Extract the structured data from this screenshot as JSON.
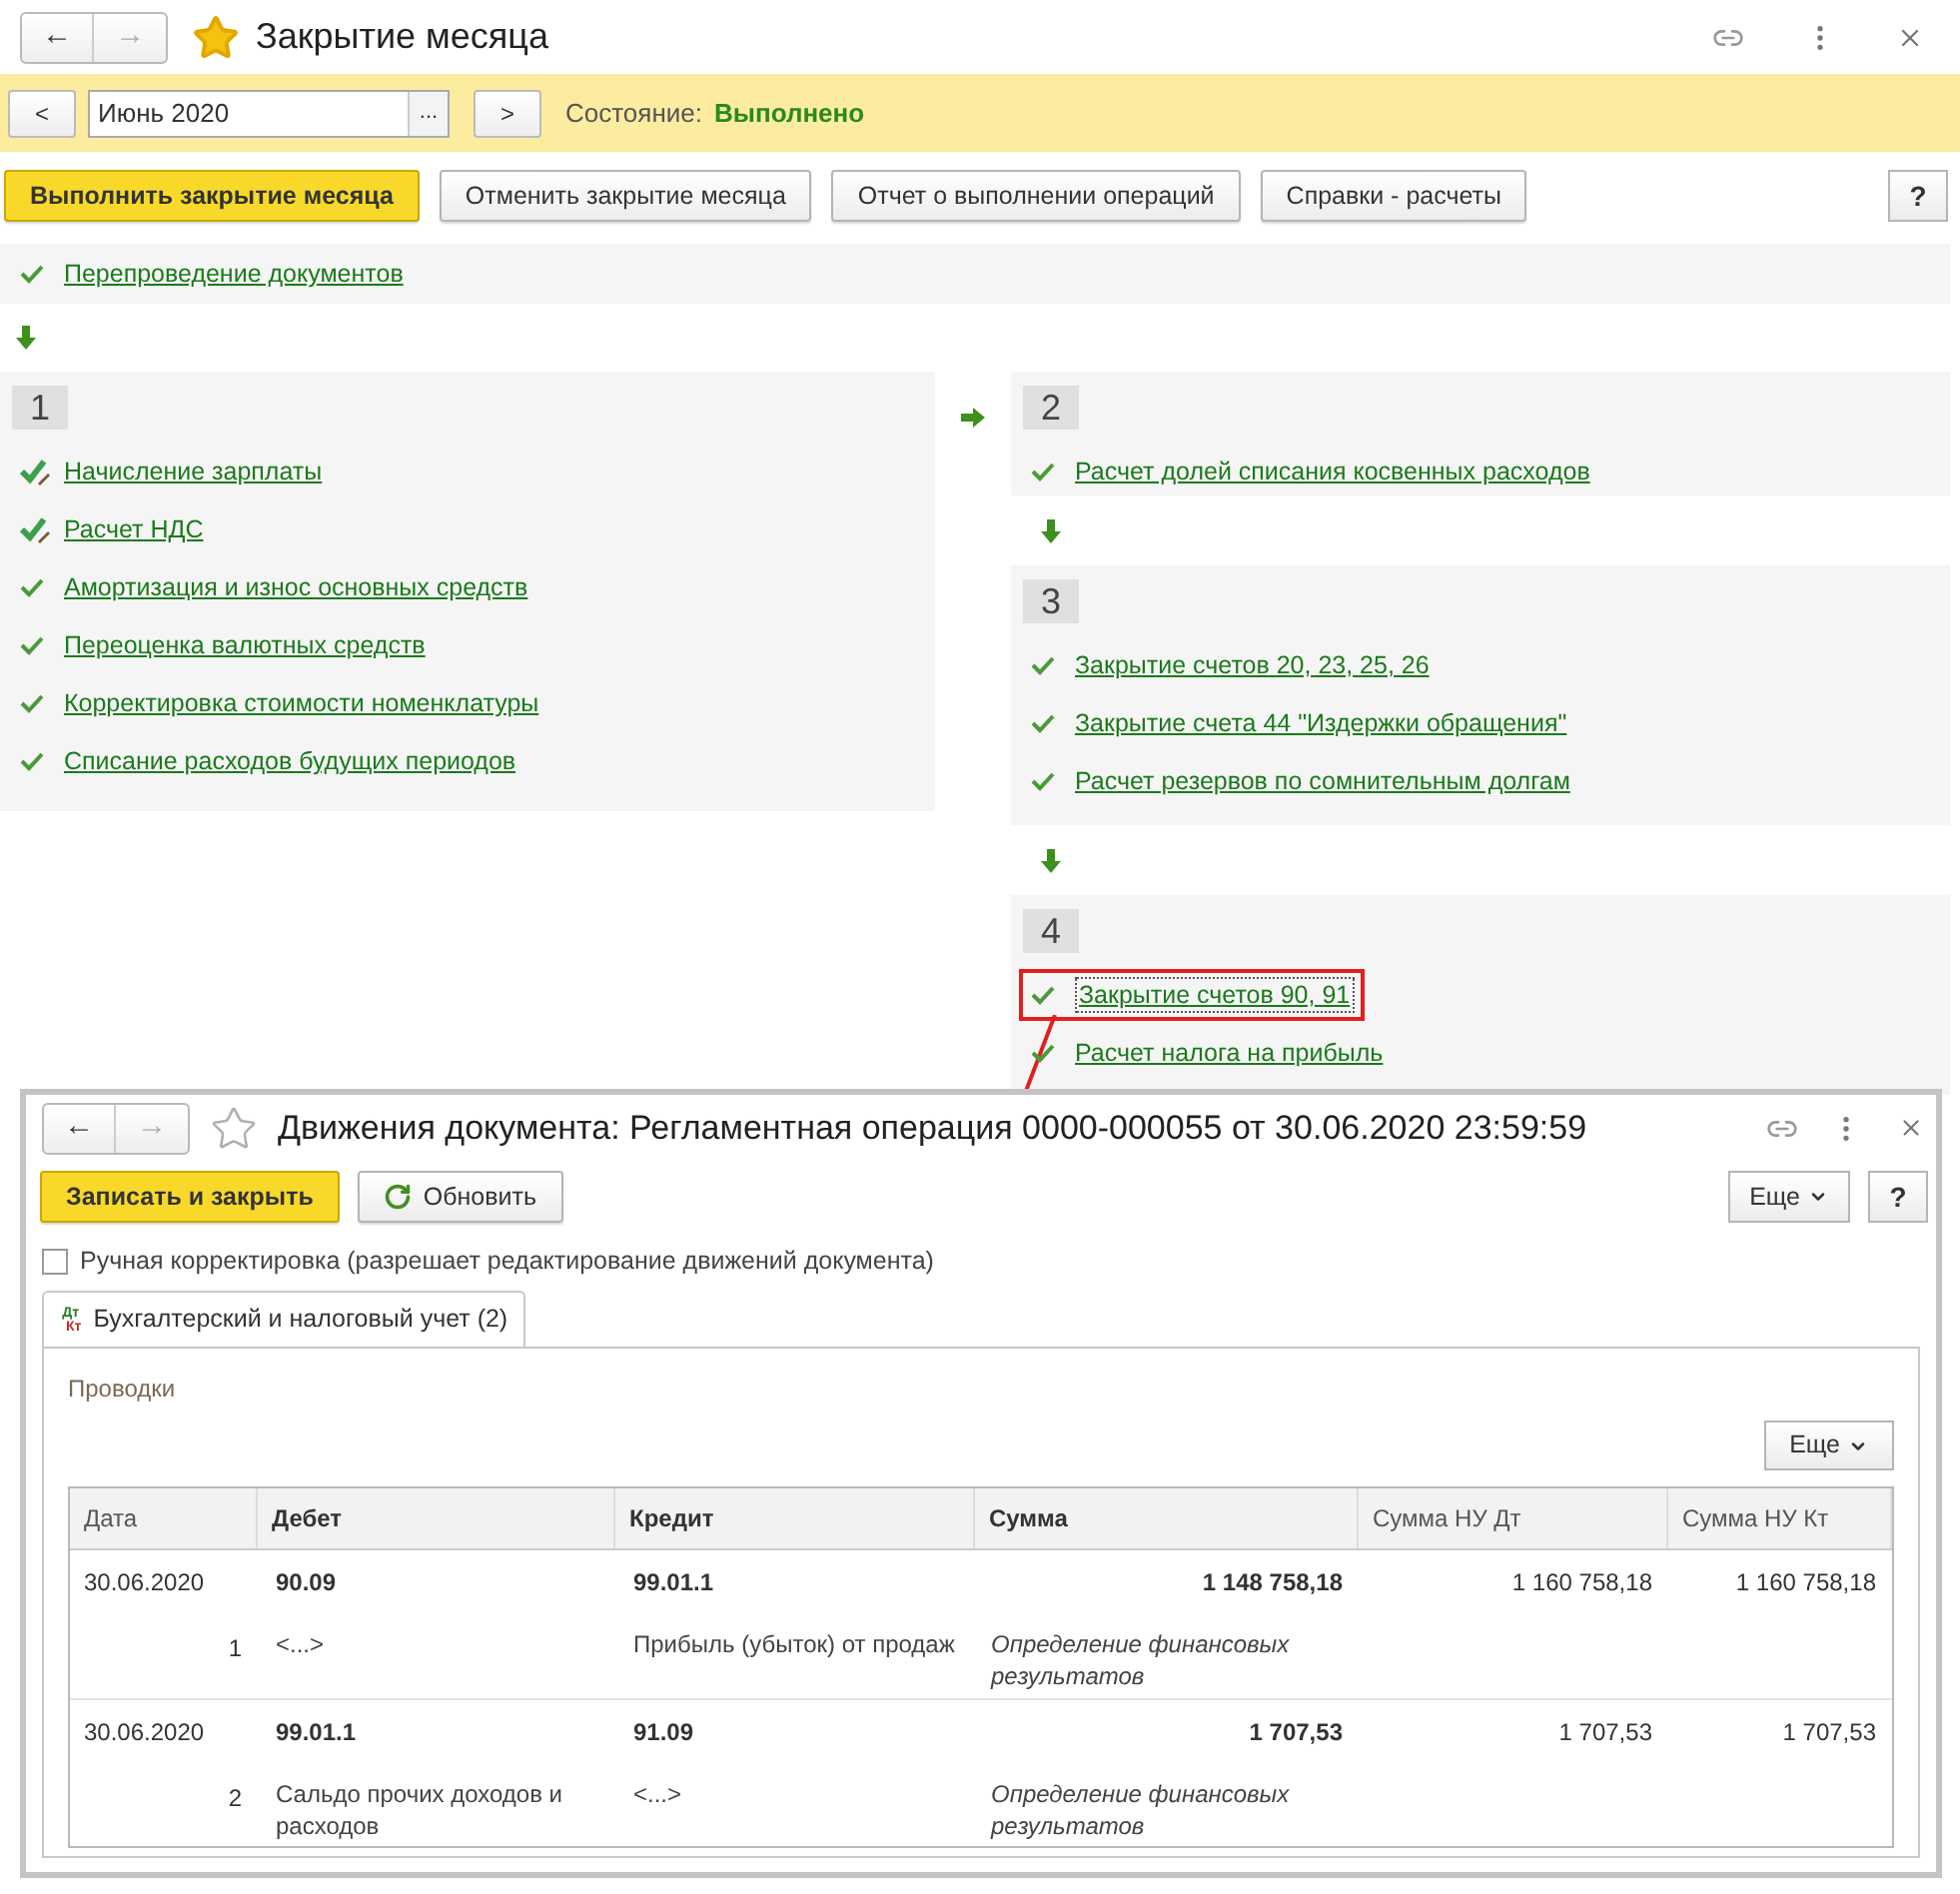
{
  "main_window": {
    "back": "←",
    "forward": "→",
    "favorite": true,
    "title": "Закрытие месяца"
  },
  "period_bar": {
    "prev": "<",
    "period": "Июнь 2020",
    "choose": "...",
    "next": ">",
    "state_label": "Состояние:",
    "state_value": "Выполнено"
  },
  "toolbar": {
    "buttons": [
      {
        "label": "Выполнить закрытие месяца",
        "kind": "primary"
      },
      {
        "label": "Отменить закрытие месяца",
        "kind": "normal"
      },
      {
        "label": "Отчет о выполнении операций",
        "kind": "normal"
      },
      {
        "label": "Справки - расчеты",
        "kind": "normal"
      }
    ],
    "help": "?"
  },
  "pre_step": {
    "label": "Перепроведение документов",
    "kind": "done"
  },
  "steps": [
    {
      "number": "1",
      "items": [
        {
          "label": "Начисление зарплаты",
          "kind": "done_edited",
          "highlighted": false
        },
        {
          "label": "Расчет НДС",
          "kind": "done_edited",
          "highlighted": false
        },
        {
          "label": "Амортизация и износ основных средств",
          "kind": "done",
          "highlighted": false
        },
        {
          "label": "Переоценка валютных средств",
          "kind": "done",
          "highlighted": false
        },
        {
          "label": "Корректировка стоимости номенклатуры",
          "kind": "done",
          "highlighted": false
        },
        {
          "label": "Списание расходов будущих периодов",
          "kind": "done",
          "highlighted": false
        }
      ]
    },
    {
      "number": "2",
      "items": [
        {
          "label": "Расчет долей списания косвенных расходов",
          "kind": "done",
          "highlighted": false
        }
      ]
    },
    {
      "number": "3",
      "items": [
        {
          "label": "Закрытие счетов 20, 23, 25, 26",
          "kind": "done",
          "highlighted": false
        },
        {
          "label": "Закрытие счета 44 \"Издержки обращения\"",
          "kind": "done",
          "highlighted": false
        },
        {
          "label": "Расчет резервов по сомнительным долгам",
          "kind": "done",
          "highlighted": false
        }
      ]
    },
    {
      "number": "4",
      "items": [
        {
          "label": "Закрытие счетов 90, 91",
          "kind": "done",
          "highlighted": true
        },
        {
          "label": "Расчет налога на прибыль",
          "kind": "done",
          "highlighted": false
        }
      ]
    }
  ],
  "document_window": {
    "back": "←",
    "forward": "→",
    "favorite": false,
    "title": "Движения документа: Регламентная операция 0000-000055 от 30.06.2020 23:59:59",
    "buttons": [
      {
        "label": "Записать и закрыть",
        "kind": "primary"
      },
      {
        "label": "Обновить",
        "kind": "refresh"
      }
    ],
    "more": "Еще",
    "help": "?",
    "manual_checkbox": {
      "label": "Ручная корректировка (разрешает редактирование движений документа)",
      "checked": false
    },
    "tabs": [
      {
        "label": "Бухгалтерский и налоговый учет (2)",
        "icon_top": "Дт",
        "icon_bottom": "Кт",
        "selected": true
      }
    ],
    "section_title": "Проводки",
    "table_more": "Еще",
    "table": {
      "columns": [
        "Дата",
        "Дебет",
        "Кредит",
        "Сумма",
        "Сумма НУ Дт",
        "Сумма НУ Кт"
      ],
      "rows": [
        {
          "date": "30.06.2020",
          "debit": "90.09",
          "credit": "99.01.1",
          "amount": "1 148 758,18",
          "nu_dt": "1 160 758,18",
          "nu_kt": "1 160 758,18",
          "line": "1",
          "debit_sub": "<...>",
          "credit_sub": "Прибыль (убыток) от продаж",
          "content": "Определение финансовых результатов"
        },
        {
          "date": "30.06.2020",
          "debit": "99.01.1",
          "credit": "91.09",
          "amount": "1 707,53",
          "nu_dt": "1 707,53",
          "nu_kt": "1 707,53",
          "line": "2",
          "debit_sub": "Сальдо прочих доходов и расходов",
          "credit_sub": "<...>",
          "content": "Определение финансовых результатов"
        }
      ]
    }
  }
}
